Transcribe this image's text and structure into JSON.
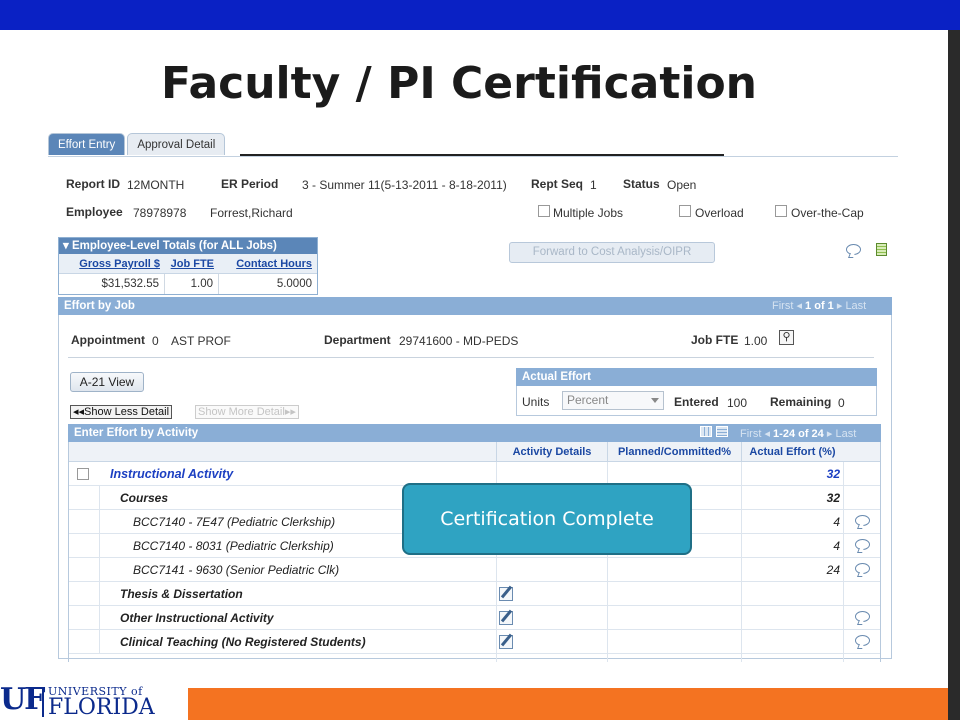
{
  "slide": {
    "title": "Faculty / PI Certification"
  },
  "tabs": [
    {
      "label": "Effort Entry",
      "active": true
    },
    {
      "label": "Approval Detail",
      "active": false
    }
  ],
  "header": {
    "report_id_label": "Report ID",
    "report_id": "12MONTH",
    "er_period_label": "ER Period",
    "er_period": "3 - Summer 11(5-13-2011 - 8-18-2011)",
    "rept_seq_label": "Rept Seq",
    "rept_seq": "1",
    "status_label": "Status",
    "status": "Open",
    "employee_label": "Employee",
    "employee_id": "78978978",
    "employee_name": "Forrest,Richard",
    "multiple_jobs": "Multiple Jobs",
    "overload": "Overload",
    "over_the_cap": "Over-the-Cap"
  },
  "employee_totals": {
    "title": "Employee-Level Totals (for ALL Jobs)",
    "columns": [
      "Gross Payroll $",
      "Job FTE",
      "Contact Hours"
    ],
    "values": [
      "$31,532.55",
      "1.00",
      "5.0000"
    ]
  },
  "forward_button": "Forward to Cost Analysis/OIPR",
  "effort_by_job": {
    "title": "Effort by Job",
    "nav_first": "First",
    "nav_range": "1 of 1",
    "nav_last": "Last",
    "appointment_label": "Appointment",
    "appointment_num": "0",
    "appointment": "AST PROF",
    "department_label": "Department",
    "department": "29741600 - MD-PEDS",
    "job_fte_label": "Job FTE",
    "job_fte": "1.00"
  },
  "a21_button": "A-21 View",
  "show_less": "Show Less Detail",
  "show_more": "Show More Detail",
  "actual_effort": {
    "title": "Actual Effort",
    "units_label": "Units",
    "units_value": "Percent",
    "entered_label": "Entered",
    "entered": "100",
    "remaining_label": "Remaining",
    "remaining": "0"
  },
  "activity": {
    "title": "Enter Effort by Activity",
    "nav_first": "First",
    "nav_range": "1-24 of 24",
    "nav_last": "Last",
    "columns": [
      "Activity Details",
      "Planned/Committed%",
      "Actual Effort (%)"
    ],
    "rows": [
      {
        "label": "Instructional Activity",
        "value": "32"
      },
      {
        "label": "Courses",
        "value": "32"
      },
      {
        "label": "BCC7140 - 7E47 (Pediatric Clerkship)",
        "value": "4"
      },
      {
        "label": "BCC7140 - 8031 (Pediatric Clerkship)",
        "value": "4"
      },
      {
        "label": "BCC7141 - 9630 (Senior Pediatric Clk)",
        "value": "24"
      },
      {
        "label": "Thesis & Dissertation",
        "value": ""
      },
      {
        "label": "Other Instructional Activity",
        "value": ""
      },
      {
        "label": "Clinical Teaching (No Registered Students)",
        "value": ""
      }
    ]
  },
  "overlay": {
    "message": "Certification Complete"
  },
  "footer": {
    "logo_mark": "UF",
    "logo_university": "UNIVERSITY of",
    "logo_florida": "FLORIDA"
  },
  "icons": [
    "comment-icon",
    "spreadsheet-icon",
    "search-icon",
    "edit-icon",
    "nav-arrow-icon",
    "collapse-icon"
  ],
  "colors": {
    "top_bar": "#0a21c4",
    "accent_orange": "#f47321",
    "header_blue": "#5b86b8",
    "overlay": "#2fa3c2"
  }
}
